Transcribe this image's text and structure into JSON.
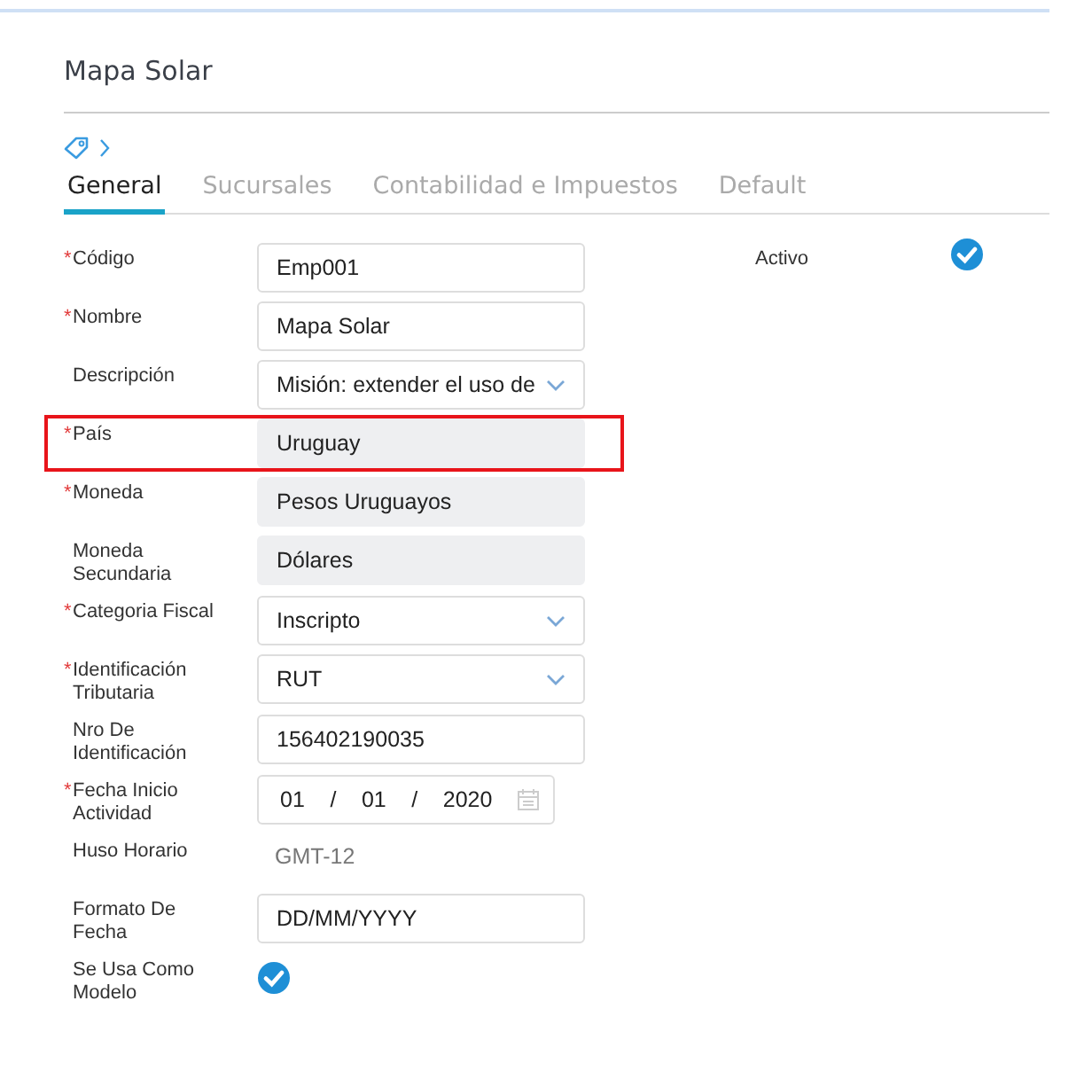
{
  "title": "Mapa Solar",
  "required_mark": "*",
  "tabs": [
    {
      "label": "General",
      "selected": true
    },
    {
      "label": "Sucursales",
      "selected": false
    },
    {
      "label": "Contabilidad e Impuestos",
      "selected": false
    },
    {
      "label": "Default",
      "selected": false
    }
  ],
  "fields": [
    {
      "label": "Código",
      "required": true,
      "kind": "text",
      "value": "Emp001",
      "highlighted": false
    },
    {
      "label": "Nombre",
      "required": true,
      "kind": "text",
      "value": "Mapa Solar",
      "highlighted": false
    },
    {
      "label": "Descripción",
      "required": false,
      "kind": "textarea",
      "value": "Misión: extender el uso de",
      "highlighted": false
    },
    {
      "label": "País",
      "required": true,
      "kind": "readonly",
      "value": "Uruguay",
      "highlighted": true
    },
    {
      "label": "Moneda",
      "required": true,
      "kind": "readonly",
      "value": "Pesos Uruguayos",
      "highlighted": false
    },
    {
      "label": "Moneda Secundaria",
      "required": false,
      "kind": "readonly",
      "value": "Dólares",
      "highlighted": false
    },
    {
      "label": "Categoria Fiscal",
      "required": true,
      "kind": "select",
      "value": "Inscripto",
      "highlighted": false
    },
    {
      "label": "Identificación Tributaria",
      "required": true,
      "kind": "select",
      "value": "RUT",
      "highlighted": false
    },
    {
      "label": "Nro De Identificación",
      "required": false,
      "kind": "text",
      "value": "156402190035",
      "highlighted": false
    },
    {
      "label": "Fecha Inicio Actividad",
      "required": true,
      "kind": "date",
      "day": "01",
      "month": "01",
      "year": "2020",
      "separator": "/",
      "highlighted": false
    },
    {
      "label": "Huso Horario",
      "required": false,
      "kind": "plain",
      "value": "GMT-12",
      "highlighted": false
    },
    {
      "label": "Formato De Fecha",
      "required": false,
      "kind": "text",
      "value": "DD/MM/YYYY",
      "highlighted": false
    },
    {
      "label": "Se Usa Como Modelo",
      "required": false,
      "kind": "checkbox",
      "checked": true,
      "highlighted": false
    }
  ],
  "side_fields": [
    {
      "label": "Activo",
      "kind": "checkbox",
      "checked": true
    }
  ]
}
